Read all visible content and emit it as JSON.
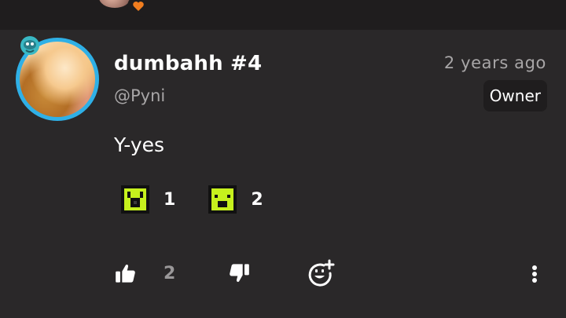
{
  "comment": {
    "username": "dumbahh #4",
    "handle": "@Pyni",
    "timestamp": "2 years ago",
    "role_badge": "Owner",
    "message": "Y-yes"
  },
  "reactions": [
    {
      "icon": "green-pixel-face-icon",
      "count": "1"
    },
    {
      "icon": "green-pixel-face-icon",
      "count": "2"
    }
  ],
  "actions": {
    "like_count": "2"
  },
  "colors": {
    "background": "#2a2829",
    "header_strip": "#1f1d1e",
    "avatar_ring": "#2fb0e6",
    "heart": "#f07d1f",
    "reaction_green": "#c6f11d",
    "muted_text": "#a8a6a7"
  }
}
